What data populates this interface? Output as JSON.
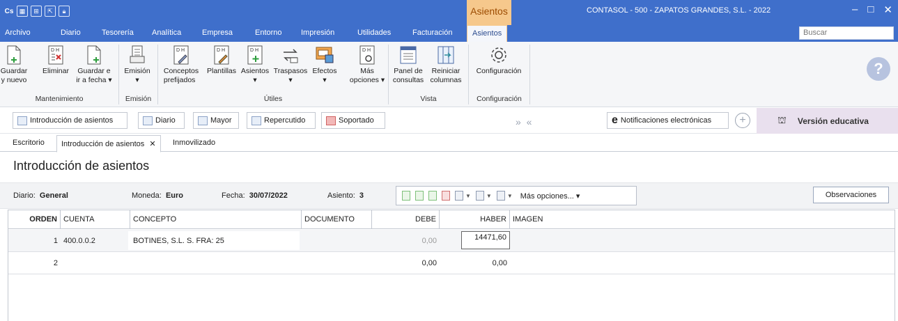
{
  "window": {
    "title": "CONTASOL - 500 - ZAPATOS GRANDES, S.L. - 2022",
    "context_tab_header": "Asientos",
    "logo": "Cs"
  },
  "menu": [
    "Archivo",
    "Diario",
    "Tesorería",
    "Analítica",
    "Empresa",
    "Entorno",
    "Impresión",
    "Utilidades",
    "Facturación",
    "Asientos"
  ],
  "search": {
    "placeholder": "Buscar"
  },
  "ribbon": {
    "buttons": [
      {
        "label": "Guardar\ny nuevo"
      },
      {
        "label": "Eliminar"
      },
      {
        "label": "Guardar e\nir a fecha ▾"
      },
      {
        "label": "Emisión\n▾"
      },
      {
        "label": "Conceptos\nprefijados"
      },
      {
        "label": "Plantillas"
      },
      {
        "label": "Asientos\n▾"
      },
      {
        "label": "Traspasos\n▾"
      },
      {
        "label": "Efectos\n▾"
      },
      {
        "label": "Más\nopciones ▾"
      },
      {
        "label": "Panel de\nconsultas"
      },
      {
        "label": "Reiniciar\ncolumnas"
      },
      {
        "label": "Configuración"
      }
    ],
    "groups": [
      "Mantenimiento",
      "Emisión",
      "Útiles",
      "Vista",
      "Configuración"
    ]
  },
  "shortcuts": [
    "Introducción de asientos",
    "Diario",
    "Mayor",
    "Repercutido",
    "Soportado",
    "Notificaciones electrónicas"
  ],
  "edu_label": "Versión educativa",
  "doc_tabs": [
    "Escritorio",
    "Introducción de asientos",
    "Inmovilizado"
  ],
  "page_title": "Introducción de asientos",
  "info": {
    "diario_label": "Diario:",
    "diario": "General",
    "moneda_label": "Moneda:",
    "moneda": "Euro",
    "fecha_label": "Fecha:",
    "fecha": "30/07/2022",
    "asiento_label": "Asiento:",
    "asiento": "3",
    "more_options": "Más opciones...",
    "observaciones": "Observaciones"
  },
  "table": {
    "headers": [
      "ORDEN",
      "CUENTA",
      "CONCEPTO",
      "DOCUMENTO",
      "DEBE",
      "HABER",
      "IMAGEN"
    ],
    "rows": [
      {
        "orden": "1",
        "cuenta": "400.0.0.2",
        "concepto": "BOTINES, S.L. S. FRA: 25",
        "documento": "",
        "debe": "0,00",
        "haber": "14471,60"
      },
      {
        "orden": "2",
        "cuenta": "",
        "concepto": "",
        "documento": "",
        "debe": "0,00",
        "haber": "0,00"
      }
    ]
  }
}
